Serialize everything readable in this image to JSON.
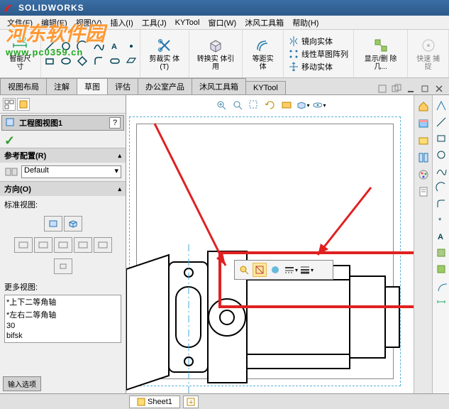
{
  "app": {
    "brand": "SOLIDWORKS"
  },
  "menu": {
    "file": "文件(F)",
    "edit": "编辑(E)",
    "view": "视图(V)",
    "insert": "插入(I)",
    "tools": "工具(J)",
    "kytool": "KYTool",
    "window": "窗口(W)",
    "mufeng": "沐风工具箱",
    "help": "帮助(H)"
  },
  "watermark": {
    "main": "河东软件园",
    "sub": "www.pc0359.cn"
  },
  "ribbon": {
    "smartdim": "智能尺\n寸",
    "trim": "剪裁实\n体(T)",
    "convert": "转换实\n体引用",
    "offset": "等距实\n体",
    "mirror": "镜向实体",
    "pattern": "线性草图阵列",
    "move": "移动实体",
    "showdel": "显示/删\n除几...",
    "quick": "快速\n捕捉"
  },
  "tabs": {
    "layout": "视图布局",
    "annot": "注解",
    "sketch": "草图",
    "eval": "评估",
    "office": "办公室产品",
    "mufeng": "沐风工具箱",
    "kytool": "KYTool"
  },
  "panel": {
    "title": "工程图视图1",
    "help": "?",
    "config_head": "参考配置(R)",
    "config_val": "Default",
    "dir_head": "方向(O)",
    "std_label": "标准视图:",
    "more_label": "更多视图:",
    "views": [
      "*上下二等角轴",
      "*左右二等角轴",
      "30",
      "bifsk"
    ],
    "bottom_tab": "输入选项"
  },
  "sheet": {
    "name": "Sheet1"
  }
}
